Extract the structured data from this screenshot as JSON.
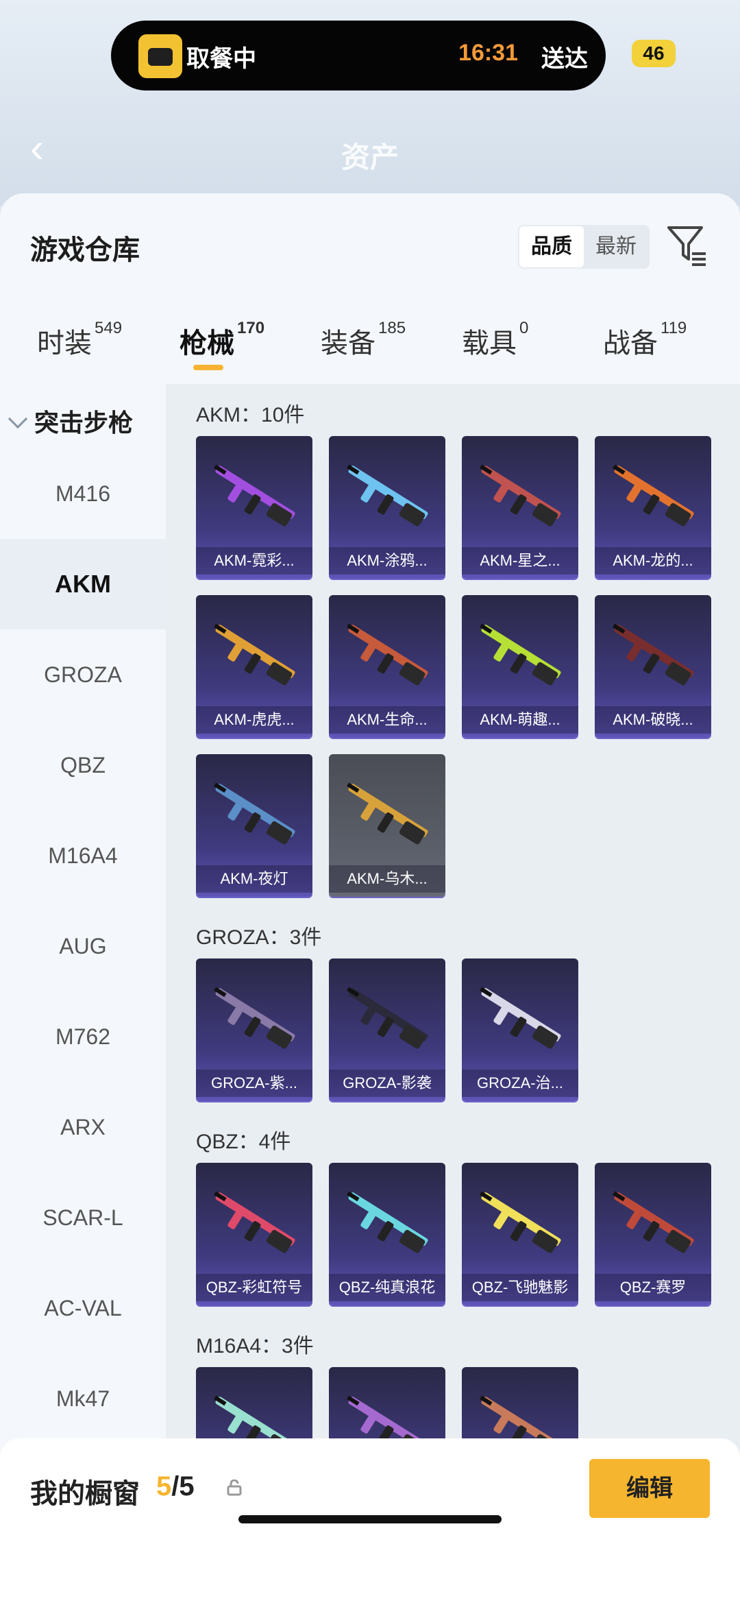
{
  "status": {
    "activity_text": "取餐中",
    "activity_time": "16:31",
    "activity_deliver": "送达",
    "battery": "46"
  },
  "header": {
    "title": "资产"
  },
  "sheet": {
    "title": "游戏仓库",
    "sort_options": [
      "品质",
      "最新"
    ],
    "tabs": [
      {
        "label": "时装",
        "count": "549"
      },
      {
        "label": "枪械",
        "count": "170"
      },
      {
        "label": "装备",
        "count": "185"
      },
      {
        "label": "载具",
        "count": "0"
      },
      {
        "label": "战备",
        "count": "119"
      }
    ]
  },
  "sidebar": {
    "group": "突击步枪",
    "items": [
      "M416",
      "AKM",
      "GROZA",
      "QBZ",
      "M16A4",
      "AUG",
      "M762",
      "ARX",
      "SCAR-L",
      "AC-VAL",
      "Mk47"
    ],
    "active": "AKM"
  },
  "sections": [
    {
      "title": "AKM：10件",
      "items": [
        "AKM-霓彩...",
        "AKM-涂鸦...",
        "AKM-星之...",
        "AKM-龙的...",
        "AKM-虎虎...",
        "AKM-生命...",
        "AKM-萌趣...",
        "AKM-破晓...",
        "AKM-夜灯",
        "AKM-乌木..."
      ]
    },
    {
      "title": "GROZA：3件",
      "items": [
        "GROZA-紫...",
        "GROZA-影袭",
        "GROZA-治..."
      ]
    },
    {
      "title": "QBZ：4件",
      "items": [
        "QBZ-彩虹符号",
        "QBZ-纯真浪花",
        "QBZ-飞驰魅影",
        "QBZ-赛罗"
      ]
    },
    {
      "title": "M16A4：3件",
      "items": [
        "",
        "",
        ""
      ]
    }
  ],
  "gun_colors": [
    "#a24fe0",
    "#6fc3f0",
    "#c0524f",
    "#e2722e",
    "#e0a035",
    "#c75a3b",
    "#b6e035",
    "#7a2d2d",
    "#5a8fc7",
    "#d8a23a",
    "#8a7aa8",
    "#2a2a3a",
    "#d8d8e8",
    "#e04a6a",
    "#6ad7e0",
    "#f0e05a",
    "#c04a3a",
    "#9ae0d0",
    "#a56ad0",
    "#c87a5a"
  ],
  "bottom": {
    "title": "我的橱窗",
    "count_current": "5",
    "count_total": "/5",
    "edit_label": "编辑"
  }
}
